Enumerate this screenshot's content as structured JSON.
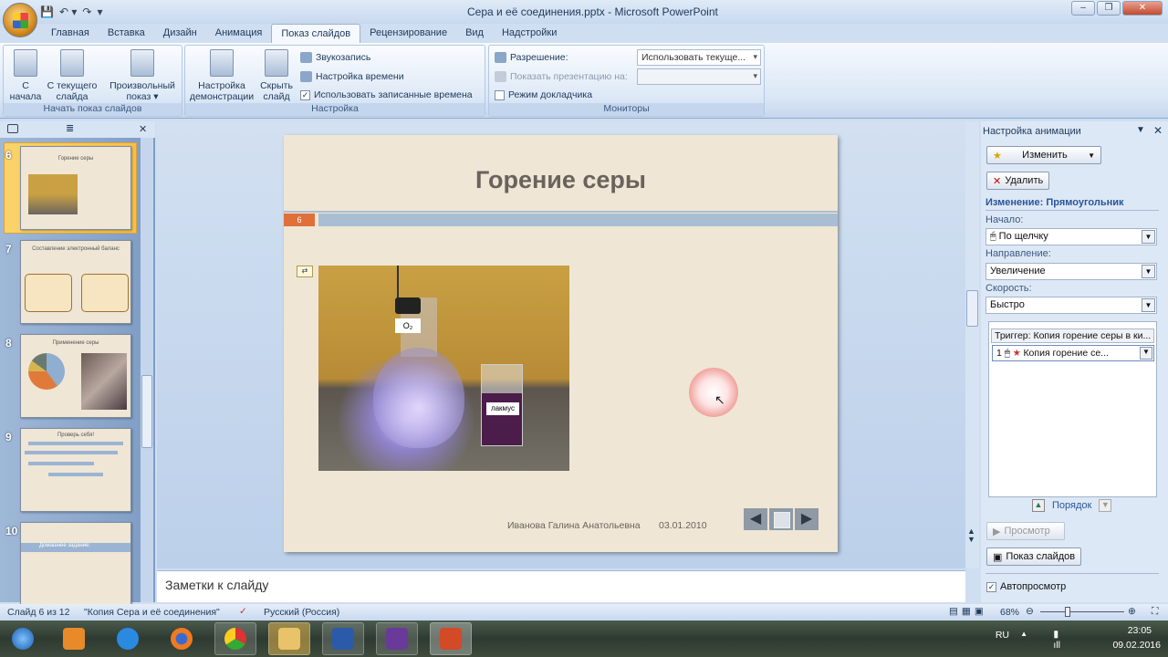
{
  "window": {
    "title": "Сера и её соединения.pptx - Microsoft PowerPoint"
  },
  "ribbon": {
    "tabs": [
      "Главная",
      "Вставка",
      "Дизайн",
      "Анимация",
      "Показ слайдов",
      "Рецензирование",
      "Вид",
      "Надстройки"
    ],
    "active_tab": "Показ слайдов",
    "start_group": {
      "label": "Начать показ слайдов",
      "from_start": "С\nначала",
      "from_current": "С текущего\nслайда",
      "custom": "Произвольный\nпоказ ▾"
    },
    "setup_group": {
      "label": "Настройка",
      "setup_show": "Настройка\nдемонстрации",
      "hide_slide": "Скрыть\nслайд",
      "record_narration": "Звукозапись",
      "rehearse": "Настройка времени",
      "use_timings": "Использовать записанные времена",
      "use_timings_checked": true
    },
    "monitors_group": {
      "label": "Мониторы",
      "resolution_label": "Разрешение:",
      "resolution_value": "Использовать текуще...",
      "show_on_label": "Показать презентацию на:",
      "show_on_value": "",
      "presenter_view": "Режим докладчика",
      "presenter_view_checked": false
    }
  },
  "slides_panel": {
    "thumbnails": [
      {
        "number": "6",
        "title": "Горение серы",
        "selected": true
      },
      {
        "number": "7",
        "title": "Составление электронный баланс"
      },
      {
        "number": "8",
        "title": "Применение серы"
      },
      {
        "number": "9",
        "title": "Проверь себя!"
      },
      {
        "number": "10",
        "title": "Домашнее задание:"
      }
    ]
  },
  "slide": {
    "title": "Горение серы",
    "number": "6",
    "photo_labels": {
      "flask": "O₂",
      "beaker": "лакмус"
    },
    "author": "Иванова Галина Анатольевна",
    "date": "03.01.2010",
    "nav": {
      "prev": "◀",
      "next": "▶"
    }
  },
  "notes": {
    "placeholder": "Заметки к слайду"
  },
  "animation_pane": {
    "title": "Настройка анимации",
    "change_button": "Изменить",
    "remove_button": "Удалить",
    "effect_heading": "Изменение: Прямоугольник",
    "start_label": "Начало:",
    "start_value": "По щелчку",
    "direction_label": "Направление:",
    "direction_value": "Увеличение",
    "speed_label": "Скорость:",
    "speed_value": "Быстро",
    "trigger": "Триггер: Копия горение серы в ки...",
    "items": [
      {
        "order": "1",
        "name": "Копия горение се..."
      }
    ],
    "reorder_label": "Порядок",
    "play_button": "Просмотр",
    "slideshow_button": "Показ слайдов",
    "autopreview_label": "Автопросмотр",
    "autopreview_checked": true
  },
  "status_bar": {
    "slide_info": "Слайд 6 из 12",
    "theme": "\"Копия Сера и её соединения\"",
    "language": "Русский (Россия)",
    "zoom": "68%"
  },
  "taskbar": {
    "language": "RU",
    "time": "23:05",
    "date": "09.02.2016"
  }
}
